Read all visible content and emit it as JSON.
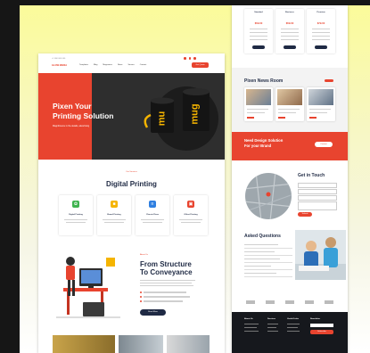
{
  "header": {
    "brand": "GLOW MEDIA",
    "contact_info": "+1 800 000 000",
    "nav": [
      "Templates",
      "Blog",
      "Magazines",
      "News",
      "Service",
      "Contact"
    ],
    "cta": "Get Quote"
  },
  "hero": {
    "title_line1": "Pixen Your",
    "title_line2": "Printing Solution",
    "subtitle": "Magnificence in the details, advertising",
    "mug_text_left": "mu",
    "mug_text_right": "mug"
  },
  "services": {
    "eyebrow": "Our Services",
    "title": "Digital Printing",
    "cards": [
      {
        "title": "Digital Printing",
        "icon": "leaf-icon",
        "color": "#3fb34f"
      },
      {
        "title": "Brand Printing",
        "icon": "box-icon",
        "color": "#f5b400"
      },
      {
        "title": "Classic Flexo",
        "icon": "layers-icon",
        "color": "#2f7fe0"
      },
      {
        "title": "Offset Printing",
        "icon": "printer-icon",
        "color": "#e8442f"
      }
    ]
  },
  "structure": {
    "eyebrow": "About Us",
    "title_line1": "From Structure",
    "title_line2": "To Conveyance",
    "button": "Read More"
  },
  "pricing": {
    "plans": [
      {
        "name": "Standard",
        "price": "$59.00"
      },
      {
        "name": "Business",
        "price": "$59.00"
      },
      {
        "name": "Premium",
        "price": "$79.00"
      }
    ]
  },
  "news": {
    "title": "Pixen News Room",
    "count": 3
  },
  "banner": {
    "title_line1": "Need Design Solution",
    "title_line2": "For your Brand",
    "button": "Contact"
  },
  "contact": {
    "title": "Get in Touch",
    "button": "Submit"
  },
  "faq": {
    "title": "Asked Questions"
  },
  "footer": {
    "columns": [
      "About Us",
      "Services",
      "Useful Links",
      "Newsletter"
    ],
    "button": "Subscribe"
  },
  "colors": {
    "accent": "#e8442f",
    "navy": "#1f2a44",
    "frame": "#fbfb9a"
  }
}
